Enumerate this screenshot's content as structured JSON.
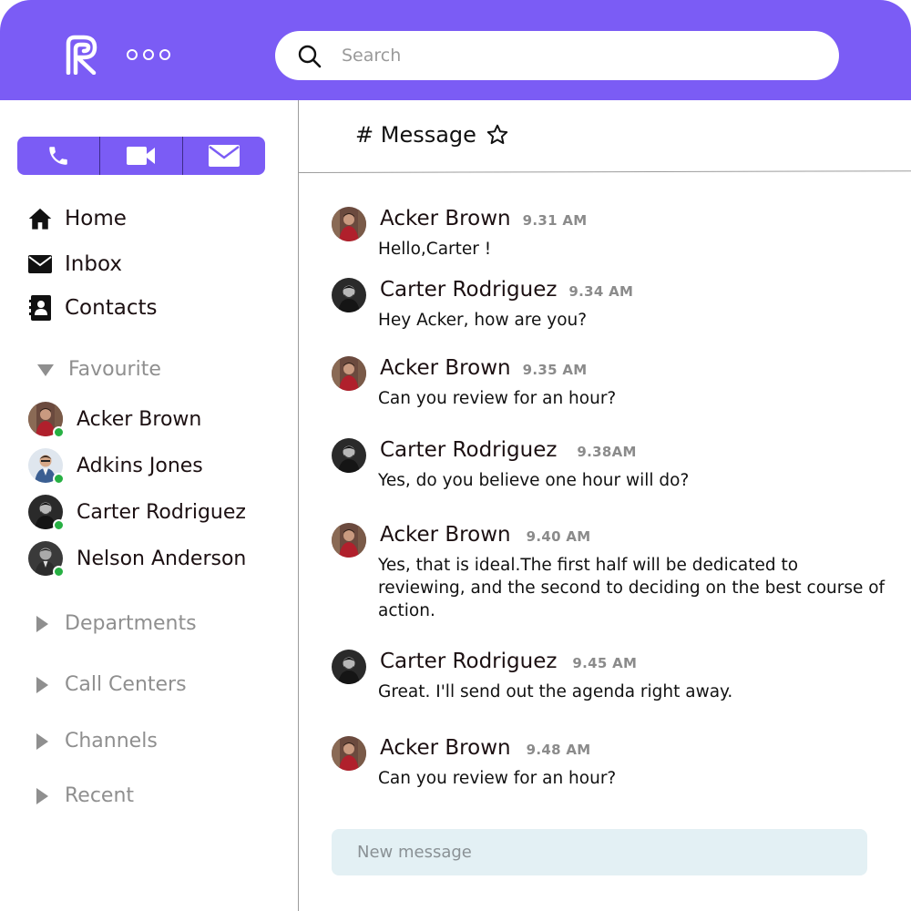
{
  "header": {
    "search_placeholder": "Search"
  },
  "quick_actions": [
    "phone-icon",
    "video-icon",
    "mail-icon"
  ],
  "colors": {
    "accent": "#7b5cf5",
    "online": "#27b043",
    "composer_bg": "#e3f0f4"
  },
  "nav": [
    {
      "icon": "home-icon",
      "label": "Home"
    },
    {
      "icon": "envelope-icon",
      "label": "Inbox"
    },
    {
      "icon": "contacts-book-icon",
      "label": "Contacts"
    }
  ],
  "favourite": {
    "label": "Favourite",
    "expanded": true,
    "contacts": [
      {
        "name": "Acker Brown",
        "online": true
      },
      {
        "name": "Adkins Jones",
        "online": true
      },
      {
        "name": "Carter Rodriguez",
        "online": true
      },
      {
        "name": "Nelson Anderson",
        "online": true
      }
    ]
  },
  "sections": [
    {
      "label": "Departments",
      "expanded": false
    },
    {
      "label": "Call Centers",
      "expanded": false
    },
    {
      "label": "Channels",
      "expanded": false
    },
    {
      "label": "Recent",
      "expanded": false
    }
  ],
  "channel": {
    "title": "# Message"
  },
  "messages": [
    {
      "sender": "Acker Brown",
      "time": "9.31 AM",
      "text": "Hello,Carter !"
    },
    {
      "sender": "Carter Rodriguez",
      "time": "9.34 AM",
      "text": "Hey Acker, how are you?"
    },
    {
      "sender": "Acker Brown",
      "time": "9.35 AM",
      "text": "Can you review for an hour?"
    },
    {
      "sender": "Carter Rodriguez",
      "time": "9.38AM",
      "text": "Yes, do you believe one hour will do?"
    },
    {
      "sender": "Acker Brown",
      "time": "9.40 AM",
      "text": "Yes, that is ideal.The first half will be dedicated to reviewing, and the second to deciding on the best course of action."
    },
    {
      "sender": "Carter Rodriguez",
      "time": "9.45 AM",
      "text": "Great. I'll send out the agenda right away."
    },
    {
      "sender": "Acker Brown",
      "time": "9.48 AM",
      "text": "Can you review for an hour?"
    }
  ],
  "composer": {
    "placeholder": "New message"
  }
}
